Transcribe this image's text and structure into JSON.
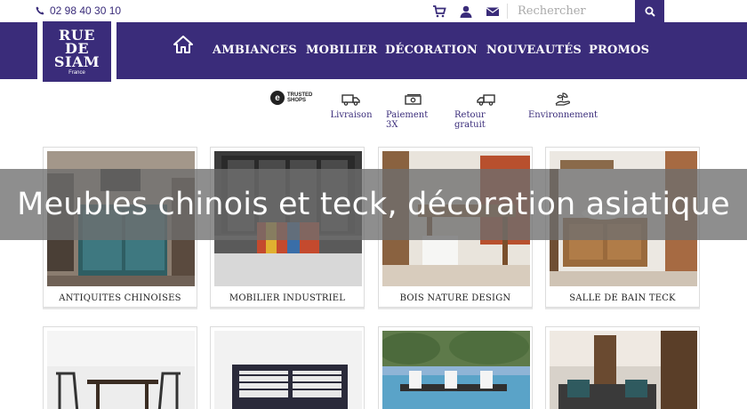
{
  "topbar": {
    "phone": "02 98 40 30 10",
    "search_placeholder": "Rechercher",
    "icons": [
      "cart-icon",
      "user-icon",
      "mail-icon"
    ]
  },
  "logo": {
    "line1": "RUE",
    "line2": "DE",
    "line3": "SIAM",
    "sub": "France"
  },
  "nav": {
    "items": [
      "AMBIANCES",
      "MOBILIER",
      "DÉCORATION",
      "NOUVEAUTÉS",
      "PROMOS"
    ]
  },
  "trust": {
    "trusted_shops_line1": "TRUSTED",
    "trusted_shops_line2": "SHOPS",
    "items": [
      "Livraison",
      "Paiement 3X",
      "Retour gratuit",
      "Environnement"
    ]
  },
  "categories": [
    "ANTIQUITES CHINOISES",
    "MOBILIER INDUSTRIEL",
    "BOIS NATURE DESIGN",
    "SALLE DE BAIN TECK"
  ],
  "overlay_title": "Meubles chinois et teck, décoration asiatique",
  "colors": {
    "brand": "#3a2c7a",
    "overlay": "#6e6e6e"
  }
}
